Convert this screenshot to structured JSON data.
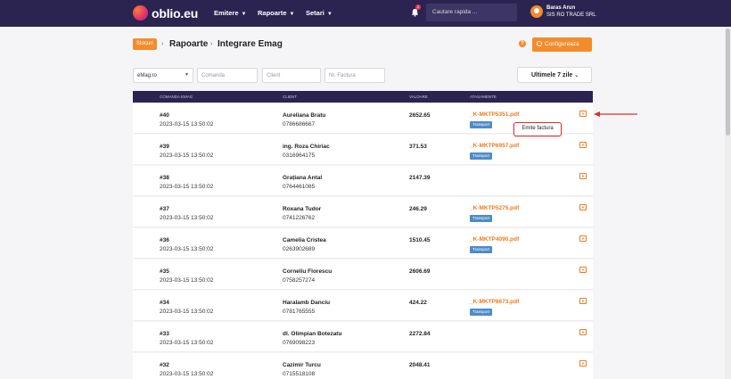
{
  "brand": {
    "name": "oblio.eu"
  },
  "nav": {
    "items": [
      {
        "label": "Emitere"
      },
      {
        "label": "Rapoarte"
      },
      {
        "label": "Setari"
      }
    ],
    "notification_count": "2",
    "search_placeholder": "Cautare rapida ...",
    "user": {
      "name": "Baras Arun",
      "company": "SIS RO TRADE SRL"
    }
  },
  "breadcrumb": {
    "badge": "Stocuri",
    "items": [
      "Rapoarte",
      "Integrare Emag"
    ]
  },
  "config_button": {
    "label": "Configureaza"
  },
  "filters": {
    "store": "eMag.ro",
    "comanda_placeholder": "Comanda",
    "client_placeholder": "Client",
    "factura_placeholder": "Nr. Factura",
    "period": "Ultimele 7 zile"
  },
  "table": {
    "headers": [
      "Comanda eMag",
      "Client",
      "Valoare",
      "Atasamente"
    ],
    "rows": [
      {
        "order": "#40",
        "date": "2023-03-15 13:50:02",
        "client": "Aureliana Bratu",
        "phone": "0786686667",
        "value": "2652.65",
        "attachment": "_K-MKTP5351.pdf",
        "tag": "Transport"
      },
      {
        "order": "#39",
        "date": "2023-03-15 13:50:02",
        "client": "ing. Roza Chiriac",
        "phone": "0316964175",
        "value": "371.53",
        "attachment": "_K-MKTP6957.pdf",
        "tag": "Transport"
      },
      {
        "order": "#38",
        "date": "2023-03-15 13:50:02",
        "client": "Grațiana Antal",
        "phone": "0764461085",
        "value": "2147.39",
        "attachment": "",
        "tag": ""
      },
      {
        "order": "#37",
        "date": "2023-03-15 13:50:02",
        "client": "Roxana Tudor",
        "phone": "0741226762",
        "value": "246.29",
        "attachment": "_K-MKTP5275.pdf",
        "tag": "Transport"
      },
      {
        "order": "#36",
        "date": "2023-03-15 13:50:02",
        "client": "Camelia Cristea",
        "phone": "0263902689",
        "value": "1510.45",
        "attachment": "_K-MKTP4090.pdf",
        "tag": "Transport"
      },
      {
        "order": "#35",
        "date": "2023-03-15 13:50:02",
        "client": "Corneliu Florescu",
        "phone": "0758257274",
        "value": "2606.69",
        "attachment": "",
        "tag": ""
      },
      {
        "order": "#34",
        "date": "2023-03-15 13:50:02",
        "client": "Haralamb Danciu",
        "phone": "0781765555",
        "value": "424.22",
        "attachment": "_K-MKTP8673.pdf",
        "tag": "Transport"
      },
      {
        "order": "#33",
        "date": "2023-03-15 13:50:02",
        "client": "dl. Olimpian Botezatu",
        "phone": "0769098223",
        "value": "2272.84",
        "attachment": "",
        "tag": ""
      },
      {
        "order": "#32",
        "date": "2023-03-15 13:50:02",
        "client": "Cazimir Turcu",
        "phone": "0715518108",
        "value": "2048.41",
        "attachment": "",
        "tag": ""
      }
    ]
  },
  "popup": {
    "label": "Emite factura"
  },
  "colors": {
    "nav_bg": "#2b2350",
    "accent": "#f48c2c",
    "tag": "#4d8bc9",
    "highlight": "#d9302c"
  }
}
